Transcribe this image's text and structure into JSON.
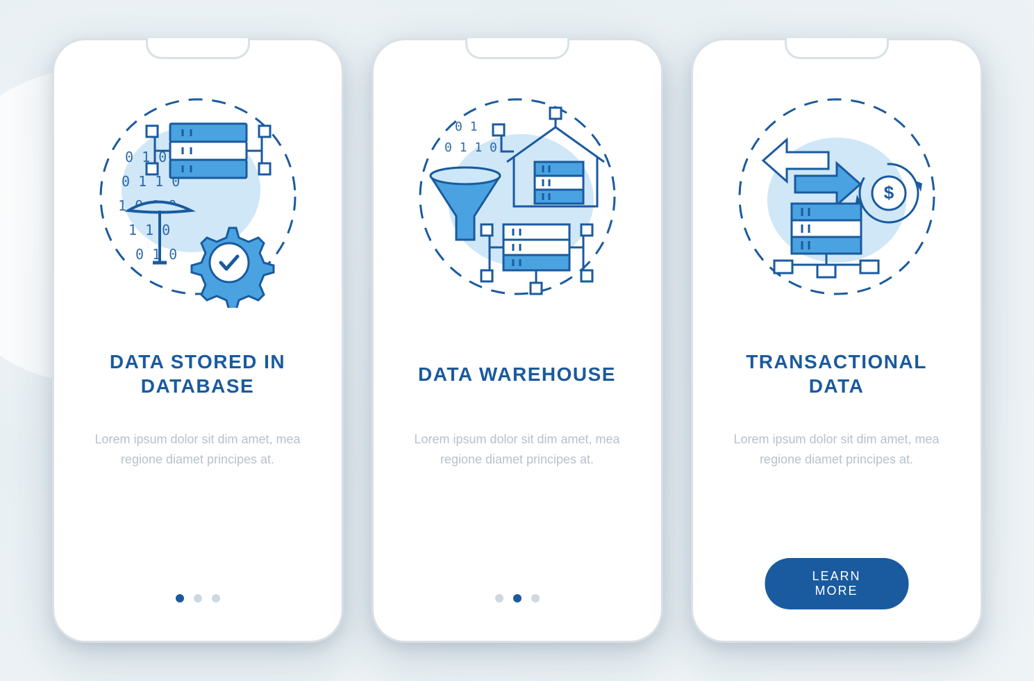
{
  "colors": {
    "primary": "#1a5a9e",
    "accent_light": "#a8d4f0",
    "stroke": "#1a5a9e",
    "muted_text": "#b8c1c9",
    "dot_inactive": "#cfd8de"
  },
  "cards": [
    {
      "icon": "database-mining-gear-icon",
      "title": "DATA STORED IN DATABASE",
      "description": "Lorem ipsum dolor sit dim amet, mea regione diamet principes at.",
      "has_dots": true,
      "active_dot": 0,
      "has_button": false
    },
    {
      "icon": "data-warehouse-funnel-icon",
      "title": "DATA WAREHOUSE",
      "description": "Lorem ipsum dolor sit dim amet, mea regione diamet principes at.",
      "has_dots": true,
      "active_dot": 1,
      "has_button": false
    },
    {
      "icon": "transactional-data-arrows-dollar-icon",
      "title": "TRANSACTIONAL DATA",
      "description": "Lorem ipsum dolor sit dim amet, mea regione diamet principes at.",
      "has_dots": false,
      "has_button": true,
      "button_label": "LEARN MORE"
    }
  ]
}
